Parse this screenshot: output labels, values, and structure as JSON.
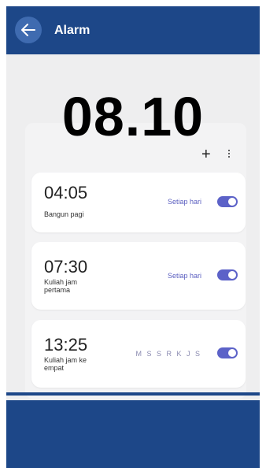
{
  "app_bar": {
    "title": "Alarm",
    "back_icon": "arrow-left-icon",
    "color": "#1d4788"
  },
  "clock": {
    "time": "08.10"
  },
  "toolbar": {
    "add_label": "+",
    "more_icon": "more-vertical-icon"
  },
  "alarms": [
    {
      "time": "04:05",
      "label": "Bangun pagi",
      "repeat": "Setiap hari",
      "enabled": true
    },
    {
      "time": "07:30",
      "label": "Kuliah jam pertama",
      "repeat": "Setiap hari",
      "enabled": true
    },
    {
      "time": "13:25",
      "label": "Kuliah jam ke empat",
      "repeat": "M S S R K J S",
      "enabled": true
    }
  ],
  "colors": {
    "accent": "#5c62c8",
    "background": "#eeeeef"
  }
}
